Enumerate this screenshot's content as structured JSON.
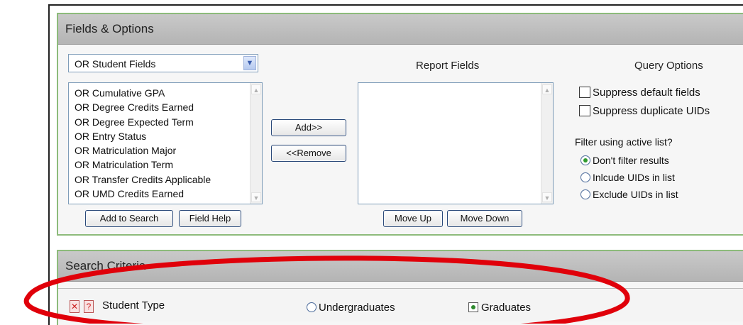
{
  "fields_options": {
    "title": "Fields & Options",
    "field_group_select": "OR Student Fields",
    "field_list": [
      "OR Cumulative GPA",
      "OR Degree Credits Earned",
      "OR Degree Expected Term",
      "OR Entry Status",
      "OR Matriculation Major",
      "OR Matriculation Term",
      "OR Transfer Credits Applicable",
      "OR UMD Credits Earned"
    ],
    "add_button": "Add>>",
    "remove_button": "<<Remove",
    "add_to_search_button": "Add to Search",
    "field_help_button": "Field Help",
    "report_fields_title": "Report Fields",
    "move_up_button": "Move Up",
    "move_down_button": "Move Down",
    "query_options_title": "Query Options",
    "suppress_default_fields": "Suppress default fields",
    "suppress_duplicate_uids": "Suppress duplicate UIDs",
    "filter_question": "Filter using active list?",
    "filter_options": [
      "Don't filter results",
      "Inlcude UIDs in list",
      "Exclude UIDs in list"
    ],
    "filter_selected": 0
  },
  "search_criteria": {
    "title": "Search Criteria",
    "remove_icon": "x-icon",
    "help_icon": "help-icon",
    "row_label": "Student Type",
    "option_undergrad": "Undergraduates",
    "option_grad": "Graduates",
    "selected": "Graduates"
  },
  "annotation_color": "#e0000a"
}
